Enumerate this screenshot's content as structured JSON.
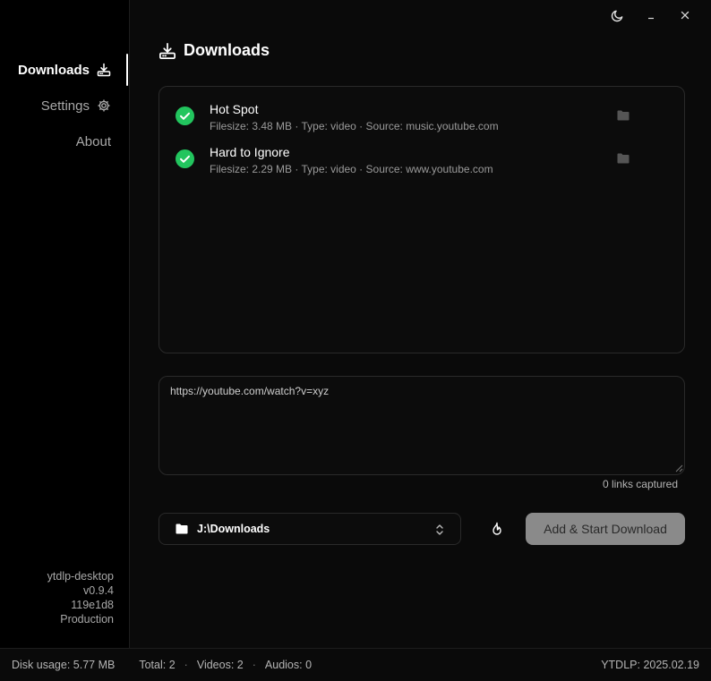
{
  "sidebar": {
    "items": [
      {
        "label": "Downloads",
        "active": true
      },
      {
        "label": "Settings",
        "active": false
      },
      {
        "label": "About",
        "active": false
      }
    ],
    "version": {
      "name": "ytdlp-desktop",
      "version": "v0.9.4",
      "commit": "119e1d8",
      "env": "Production"
    }
  },
  "main": {
    "title": "Downloads",
    "downloads": [
      {
        "name": "Hot Spot",
        "meta": "Filesize: 3.48 MB · Type: video · Source: music.youtube.com",
        "status_icon": "check-circle-icon"
      },
      {
        "name": "Hard to Ignore",
        "meta": "Filesize: 2.29 MB · Type: video · Source: www.youtube.com",
        "status_icon": "check-circle-icon"
      }
    ],
    "url_input": {
      "value": "https://youtube.com/watch?v=xyz"
    },
    "links_captured": "0 links captured",
    "folder": {
      "path": "J:\\Downloads"
    },
    "start_button": "Add & Start Download"
  },
  "footer": {
    "disk_usage": "Disk usage: 5.77 MB",
    "total": "Total: 2",
    "videos": "Videos: 2",
    "audios": "Audios: 0",
    "ytdlp": "YTDLP: 2025.02.19"
  },
  "colors": {
    "background": "#0a0a0a",
    "sidebar": "#000000",
    "success": "#22c55e",
    "button": "#8a8a8a"
  }
}
